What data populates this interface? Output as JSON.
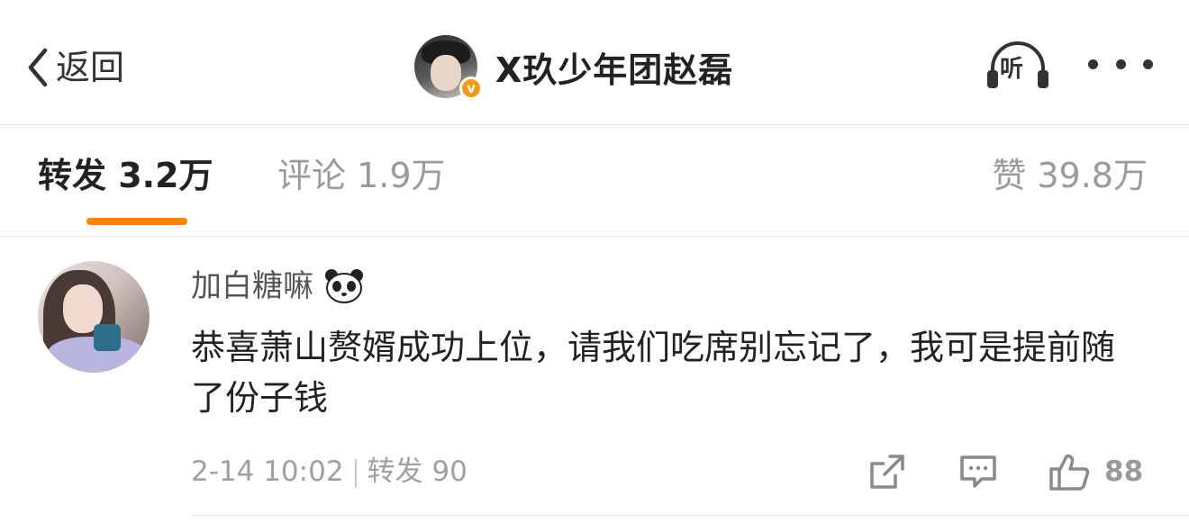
{
  "header": {
    "back_label": "返回",
    "title": "X玖少年团赵磊",
    "listen_label": "听",
    "verified_badge": "v"
  },
  "tabs": {
    "repost": "转发 3.2万",
    "comment": "评论 1.9万",
    "like": "赞 39.8万"
  },
  "comment": {
    "username": "加白糖嘛",
    "text": "恭喜萧山赘婿成功上位，请我们吃席别忘记了，我可是提前随了份子钱",
    "time": "2-14 10:02",
    "repost_label": "转发 90",
    "like_count": "88"
  },
  "colors": {
    "accent": "#ff8200",
    "badge": "#f39c12",
    "muted_text": "#9a9a9a"
  },
  "icons": {
    "back": "chevron-left-icon",
    "listen": "headphones-icon",
    "more": "more-dots-icon",
    "share": "share-icon",
    "comment": "comment-icon",
    "like": "thumbs-up-icon",
    "emoji": "panda-icon"
  }
}
